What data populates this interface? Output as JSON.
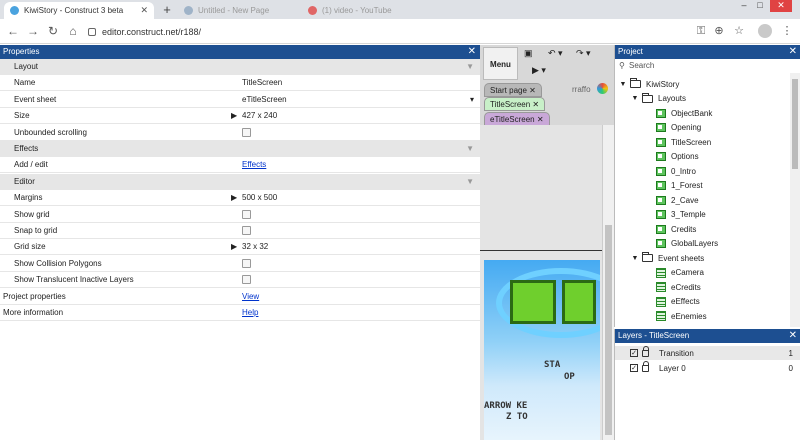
{
  "browser": {
    "tabs": [
      {
        "title": "KiwiStory - Construct 3 beta",
        "active": true
      },
      {
        "title": "Untitled - New Page",
        "active": false
      },
      {
        "title": "(1) video - YouTube",
        "active": false
      }
    ],
    "url": "editor.construct.net/r188/"
  },
  "properties": {
    "title": "Properties",
    "rows": [
      {
        "kind": "section",
        "name": "Layout"
      },
      {
        "kind": "text",
        "name": "Name",
        "value": "TitleScreen"
      },
      {
        "kind": "dropdown",
        "name": "Event sheet",
        "value": "eTitleScreen"
      },
      {
        "kind": "expand",
        "name": "Size",
        "value": "427 x 240"
      },
      {
        "kind": "check",
        "name": "Unbounded scrolling"
      },
      {
        "kind": "section",
        "name": "Effects"
      },
      {
        "kind": "link",
        "name": "Add / edit",
        "value": "Effects"
      },
      {
        "kind": "section",
        "name": "Editor"
      },
      {
        "kind": "expand",
        "name": "Margins",
        "value": "500 x 500"
      },
      {
        "kind": "check",
        "name": "Show grid"
      },
      {
        "kind": "check",
        "name": "Snap to grid"
      },
      {
        "kind": "expand",
        "name": "Grid size",
        "value": "32 x 32"
      },
      {
        "kind": "check",
        "name": "Show Collision Polygons"
      },
      {
        "kind": "check",
        "name": "Show Translucent Inactive Layers"
      },
      {
        "kind": "toplink",
        "name": "Project properties",
        "value": "View"
      },
      {
        "kind": "toplink",
        "name": "More information",
        "value": "Help"
      }
    ]
  },
  "editor": {
    "menu_label": "Menu",
    "user": "rraffo",
    "tabs": [
      "Start page",
      "TitleScreen",
      "eTitleScreen"
    ],
    "game_text": [
      "STA",
      "OP",
      "ARROW KE",
      "Z TO"
    ]
  },
  "project": {
    "title": "Project",
    "search_placeholder": "Search",
    "root": "KiwiStory",
    "layouts_folder": "Layouts",
    "layouts": [
      "ObjectBank",
      "Opening",
      "TitleScreen",
      "Options",
      "0_Intro",
      "1_Forest",
      "2_Cave",
      "3_Temple",
      "Credits",
      "GlobalLayers"
    ],
    "events_folder": "Event sheets",
    "event_sheets": [
      "eCamera",
      "eCredits",
      "eEffects",
      "eEnemies"
    ]
  },
  "layers": {
    "title": "Layers - TitleScreen",
    "rows": [
      {
        "name": "Transition",
        "num": "1"
      },
      {
        "name": "Layer 0",
        "num": "0"
      }
    ]
  }
}
